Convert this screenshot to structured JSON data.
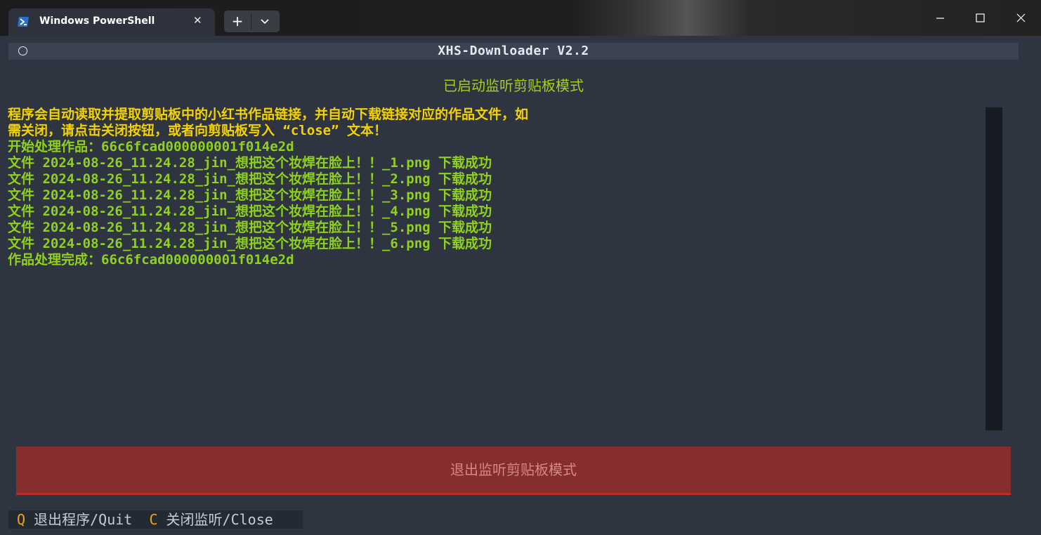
{
  "window": {
    "tab_title": "Windows PowerShell",
    "tab_icon": "powershell-icon",
    "new_tab_label": "+",
    "controls": [
      "minimize-icon",
      "maximize-icon",
      "close-icon"
    ]
  },
  "app": {
    "title": "XHS-Downloader V2.2",
    "mode_title": "已启动监听剪贴板模式",
    "log": [
      {
        "text": "程序会自动读取并提取剪贴板中的小红书作品链接，并自动下载链接对应的作品文件，如",
        "color": "#f3d200"
      },
      {
        "text": "需关闭，请点击关闭按钮，或者向剪贴板写入 “close” 文本！",
        "color": "#f3d200"
      },
      {
        "text": "开始处理作品：66c6fcad000000001f014e2d",
        "color": "#8fd11c"
      },
      {
        "text": "文件 2024-08-26_11.24.28_jin_想把这个妆焊在脸上！！_1.png 下载成功",
        "color": "#8fd11c"
      },
      {
        "text": "文件 2024-08-26_11.24.28_jin_想把这个妆焊在脸上！！_2.png 下载成功",
        "color": "#8fd11c"
      },
      {
        "text": "文件 2024-08-26_11.24.28_jin_想把这个妆焊在脸上！！_3.png 下载成功",
        "color": "#8fd11c"
      },
      {
        "text": "文件 2024-08-26_11.24.28_jin_想把这个妆焊在脸上！！_4.png 下载成功",
        "color": "#8fd11c"
      },
      {
        "text": "文件 2024-08-26_11.24.28_jin_想把这个妆焊在脸上！！_5.png 下载成功",
        "color": "#8fd11c"
      },
      {
        "text": "文件 2024-08-26_11.24.28_jin_想把这个妆焊在脸上！！_6.png 下载成功",
        "color": "#8fd11c"
      },
      {
        "text": "作品处理完成：66c6fcad000000001f014e2d",
        "color": "#8fd11c"
      }
    ],
    "exit_button_label": "退出监听剪贴板模式",
    "footer": {
      "quit_key": "Q",
      "quit_label": "退出程序/Quit",
      "close_key": "C",
      "close_label": "关闭监听/Close"
    }
  },
  "colors": {
    "background": "#2e3440",
    "header": "#3b4252",
    "accent_green": "#8fd11c",
    "accent_yellow": "#f3d200",
    "danger": "#862e2e",
    "key": "#f2a21b"
  }
}
